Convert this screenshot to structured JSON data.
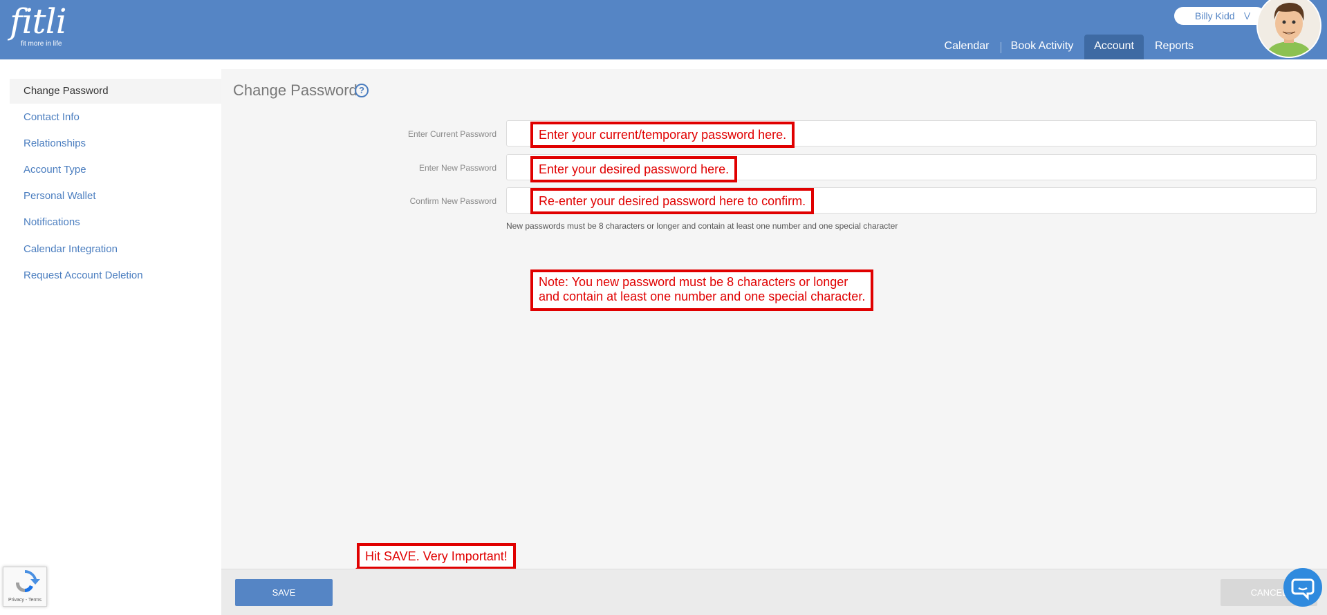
{
  "header": {
    "logo_word": "fitli",
    "logo_tagline": "fit more in life",
    "user_name": "Billy Kidd",
    "user_chevron": "chevron-down-icon",
    "nav": [
      {
        "label": "Calendar"
      },
      {
        "label": "Book Activity"
      },
      {
        "label": "Account",
        "active": true
      },
      {
        "label": "Reports"
      }
    ]
  },
  "sidebar": {
    "items": [
      {
        "label": "Change Password",
        "active": true
      },
      {
        "label": "Contact Info"
      },
      {
        "label": "Relationships"
      },
      {
        "label": "Account Type"
      },
      {
        "label": "Personal Wallet"
      },
      {
        "label": "Notifications"
      },
      {
        "label": "Calendar Integration"
      },
      {
        "label": "Request Account Deletion"
      }
    ]
  },
  "main": {
    "title": "Change Password",
    "help_icon": "?",
    "fields": [
      {
        "label": "Enter Current Password",
        "value": "",
        "callout": "Enter your current/temporary password here."
      },
      {
        "label": "Enter New Password",
        "value": "",
        "callout": "Enter your desired password here."
      },
      {
        "label": "Confirm New Password",
        "value": "",
        "callout": "Re-enter your desired password here to confirm."
      }
    ],
    "hint": "New passwords must be 8 characters or longer and contain at least one number and one special character",
    "note_line1": "Note: You new password must be 8 characters or longer",
    "note_line2": "and contain at least one number and one special character."
  },
  "footer": {
    "save_label": "SAVE",
    "cancel_label": "CANCEL",
    "save_callout": "Hit SAVE. Very Important!"
  },
  "recaptcha": {
    "text": "Privacy - Terms"
  },
  "colors": {
    "header": "#5585c5",
    "nav_active": "#3e6aa3",
    "link": "#4a7dbf",
    "callout": "#e00000",
    "chat": "#2f8ade"
  }
}
